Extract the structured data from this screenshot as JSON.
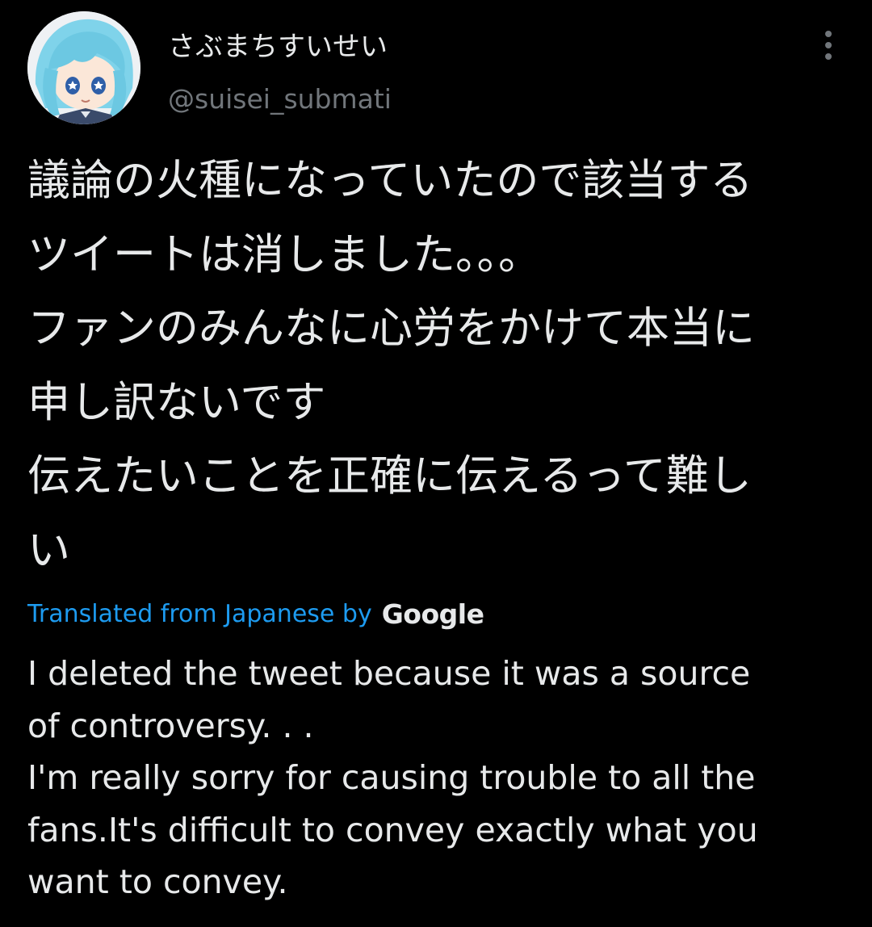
{
  "author": {
    "display_name": "さぶまちすいせい",
    "handle": "@suisei_submati",
    "avatar_icon": "avatar-image"
  },
  "menu": {
    "icon": "more-options-icon"
  },
  "tweet": {
    "lines": [
      "議論の火種になっていたので該当する",
      "ツイートは消しました。。。",
      "ファンのみんなに心労をかけて本当に",
      "申し訳ないです",
      "伝えたいことを正確に伝えるって難し",
      "い"
    ]
  },
  "translation": {
    "label": "Translated from Japanese by",
    "provider": "Google",
    "label_color": "#1d9bf0",
    "lines": [
      "I deleted the tweet because it was a source",
      "of controversy. . .",
      "I'm really sorry for causing trouble to all the",
      "fans.It's difficult to convey exactly what you",
      "want to convey."
    ]
  },
  "colors": {
    "background": "#000000",
    "primary_text": "#e7e9ea",
    "secondary_text": "#71767b",
    "accent": "#1d9bf0"
  }
}
